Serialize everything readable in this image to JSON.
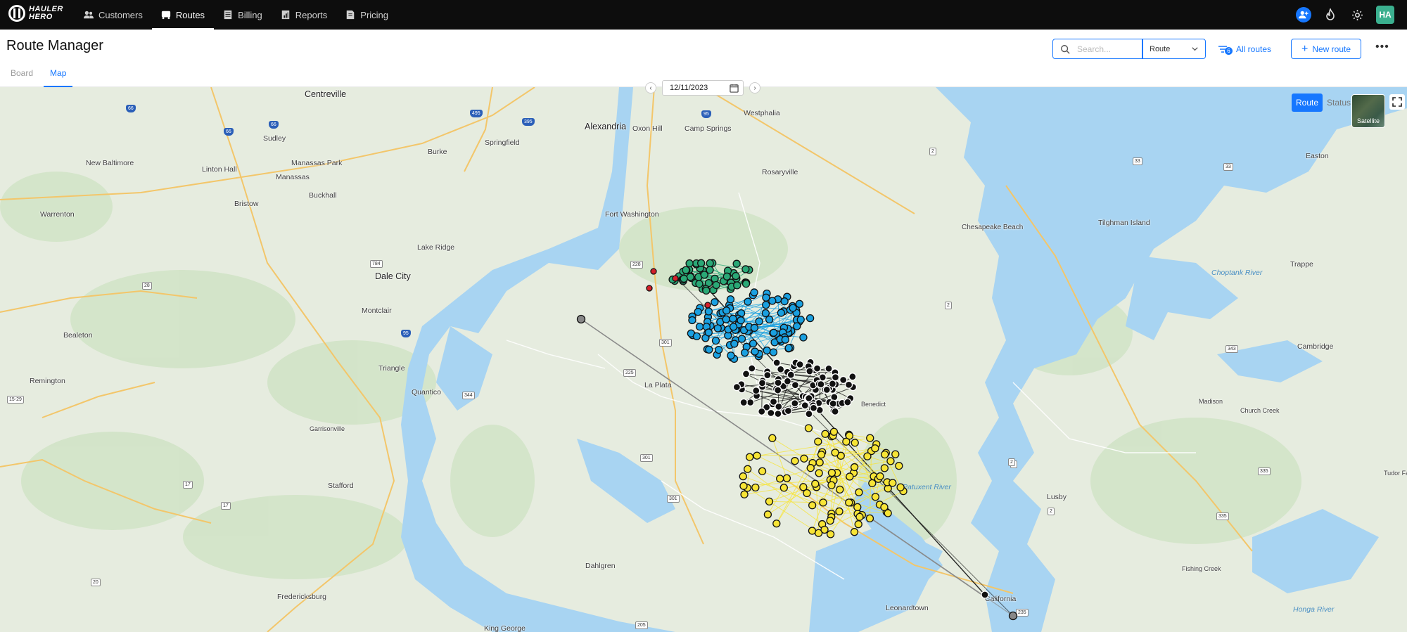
{
  "app": {
    "logo_text_line1": "HAULER",
    "logo_text_line2": "HERO",
    "nav": [
      {
        "label": "Customers",
        "icon": "customers-icon"
      },
      {
        "label": "Routes",
        "icon": "truck-icon"
      },
      {
        "label": "Billing",
        "icon": "billing-icon"
      },
      {
        "label": "Reports",
        "icon": "reports-icon"
      },
      {
        "label": "Pricing",
        "icon": "pricing-icon"
      }
    ],
    "active_nav": "Routes",
    "user_initials": "HA"
  },
  "header": {
    "title": "Route Manager",
    "tabs": [
      "Board",
      "Map"
    ],
    "active_tab": "Map",
    "search_placeholder": "Search...",
    "select_value": "Route",
    "filter_count": "6",
    "filter_label": "All routes",
    "new_route_label": "New route"
  },
  "map": {
    "date": "12/11/2023",
    "view_toggle": [
      "Route",
      "Status"
    ],
    "active_view": "Route",
    "satellite_label": "Satellite",
    "route_colors": [
      "#2aa876",
      "#1aa0e0",
      "#111111",
      "#f7e436",
      "#d4202a",
      "#888888"
    ],
    "labels": [
      "Centreville",
      "Sudley",
      "New Baltimore",
      "Linton Hall",
      "Manassas Park",
      "Manassas",
      "Burke",
      "Springfield",
      "Alexandria",
      "Oxon Hill",
      "Camp Springs",
      "Westphalia",
      "Warrenton",
      "Bristow",
      "Buckhall",
      "Rosaryville",
      "Fort Washington",
      "Lake Ridge",
      "Dale City",
      "Montclair",
      "Bealeton",
      "Triangle",
      "Remington",
      "Quantico",
      "Garrisonville",
      "Stafford",
      "La Plata",
      "Chesapeake Beach",
      "Tilghman Island",
      "Easton",
      "Trappe",
      "Choptank River",
      "Cambridge",
      "Madison",
      "Church Creek",
      "Benedict",
      "Patuxent River",
      "Lusby",
      "Fishing Creek",
      "Honga River",
      "Dahlgren",
      "Fredericksburg",
      "King George",
      "Leonardtown",
      "California",
      "Tudor Fa"
    ]
  }
}
